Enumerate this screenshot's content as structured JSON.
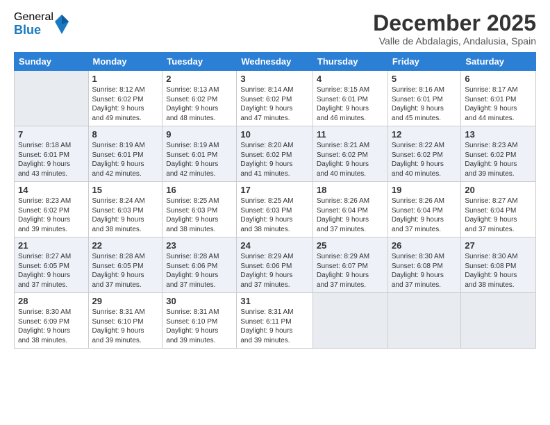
{
  "header": {
    "logo_general": "General",
    "logo_blue": "Blue",
    "month_title": "December 2025",
    "location": "Valle de Abdalagis, Andalusia, Spain"
  },
  "days_of_week": [
    "Sunday",
    "Monday",
    "Tuesday",
    "Wednesday",
    "Thursday",
    "Friday",
    "Saturday"
  ],
  "weeks": [
    [
      {
        "day": "",
        "text": ""
      },
      {
        "day": "1",
        "text": "Sunrise: 8:12 AM\nSunset: 6:02 PM\nDaylight: 9 hours\nand 49 minutes."
      },
      {
        "day": "2",
        "text": "Sunrise: 8:13 AM\nSunset: 6:02 PM\nDaylight: 9 hours\nand 48 minutes."
      },
      {
        "day": "3",
        "text": "Sunrise: 8:14 AM\nSunset: 6:02 PM\nDaylight: 9 hours\nand 47 minutes."
      },
      {
        "day": "4",
        "text": "Sunrise: 8:15 AM\nSunset: 6:01 PM\nDaylight: 9 hours\nand 46 minutes."
      },
      {
        "day": "5",
        "text": "Sunrise: 8:16 AM\nSunset: 6:01 PM\nDaylight: 9 hours\nand 45 minutes."
      },
      {
        "day": "6",
        "text": "Sunrise: 8:17 AM\nSunset: 6:01 PM\nDaylight: 9 hours\nand 44 minutes."
      }
    ],
    [
      {
        "day": "7",
        "text": "Sunrise: 8:18 AM\nSunset: 6:01 PM\nDaylight: 9 hours\nand 43 minutes."
      },
      {
        "day": "8",
        "text": "Sunrise: 8:19 AM\nSunset: 6:01 PM\nDaylight: 9 hours\nand 42 minutes."
      },
      {
        "day": "9",
        "text": "Sunrise: 8:19 AM\nSunset: 6:01 PM\nDaylight: 9 hours\nand 42 minutes."
      },
      {
        "day": "10",
        "text": "Sunrise: 8:20 AM\nSunset: 6:02 PM\nDaylight: 9 hours\nand 41 minutes."
      },
      {
        "day": "11",
        "text": "Sunrise: 8:21 AM\nSunset: 6:02 PM\nDaylight: 9 hours\nand 40 minutes."
      },
      {
        "day": "12",
        "text": "Sunrise: 8:22 AM\nSunset: 6:02 PM\nDaylight: 9 hours\nand 40 minutes."
      },
      {
        "day": "13",
        "text": "Sunrise: 8:23 AM\nSunset: 6:02 PM\nDaylight: 9 hours\nand 39 minutes."
      }
    ],
    [
      {
        "day": "14",
        "text": "Sunrise: 8:23 AM\nSunset: 6:02 PM\nDaylight: 9 hours\nand 39 minutes."
      },
      {
        "day": "15",
        "text": "Sunrise: 8:24 AM\nSunset: 6:03 PM\nDaylight: 9 hours\nand 38 minutes."
      },
      {
        "day": "16",
        "text": "Sunrise: 8:25 AM\nSunset: 6:03 PM\nDaylight: 9 hours\nand 38 minutes."
      },
      {
        "day": "17",
        "text": "Sunrise: 8:25 AM\nSunset: 6:03 PM\nDaylight: 9 hours\nand 38 minutes."
      },
      {
        "day": "18",
        "text": "Sunrise: 8:26 AM\nSunset: 6:04 PM\nDaylight: 9 hours\nand 37 minutes."
      },
      {
        "day": "19",
        "text": "Sunrise: 8:26 AM\nSunset: 6:04 PM\nDaylight: 9 hours\nand 37 minutes."
      },
      {
        "day": "20",
        "text": "Sunrise: 8:27 AM\nSunset: 6:04 PM\nDaylight: 9 hours\nand 37 minutes."
      }
    ],
    [
      {
        "day": "21",
        "text": "Sunrise: 8:27 AM\nSunset: 6:05 PM\nDaylight: 9 hours\nand 37 minutes."
      },
      {
        "day": "22",
        "text": "Sunrise: 8:28 AM\nSunset: 6:05 PM\nDaylight: 9 hours\nand 37 minutes."
      },
      {
        "day": "23",
        "text": "Sunrise: 8:28 AM\nSunset: 6:06 PM\nDaylight: 9 hours\nand 37 minutes."
      },
      {
        "day": "24",
        "text": "Sunrise: 8:29 AM\nSunset: 6:06 PM\nDaylight: 9 hours\nand 37 minutes."
      },
      {
        "day": "25",
        "text": "Sunrise: 8:29 AM\nSunset: 6:07 PM\nDaylight: 9 hours\nand 37 minutes."
      },
      {
        "day": "26",
        "text": "Sunrise: 8:30 AM\nSunset: 6:08 PM\nDaylight: 9 hours\nand 37 minutes."
      },
      {
        "day": "27",
        "text": "Sunrise: 8:30 AM\nSunset: 6:08 PM\nDaylight: 9 hours\nand 38 minutes."
      }
    ],
    [
      {
        "day": "28",
        "text": "Sunrise: 8:30 AM\nSunset: 6:09 PM\nDaylight: 9 hours\nand 38 minutes."
      },
      {
        "day": "29",
        "text": "Sunrise: 8:31 AM\nSunset: 6:10 PM\nDaylight: 9 hours\nand 39 minutes."
      },
      {
        "day": "30",
        "text": "Sunrise: 8:31 AM\nSunset: 6:10 PM\nDaylight: 9 hours\nand 39 minutes."
      },
      {
        "day": "31",
        "text": "Sunrise: 8:31 AM\nSunset: 6:11 PM\nDaylight: 9 hours\nand 39 minutes."
      },
      {
        "day": "",
        "text": ""
      },
      {
        "day": "",
        "text": ""
      },
      {
        "day": "",
        "text": ""
      }
    ]
  ]
}
